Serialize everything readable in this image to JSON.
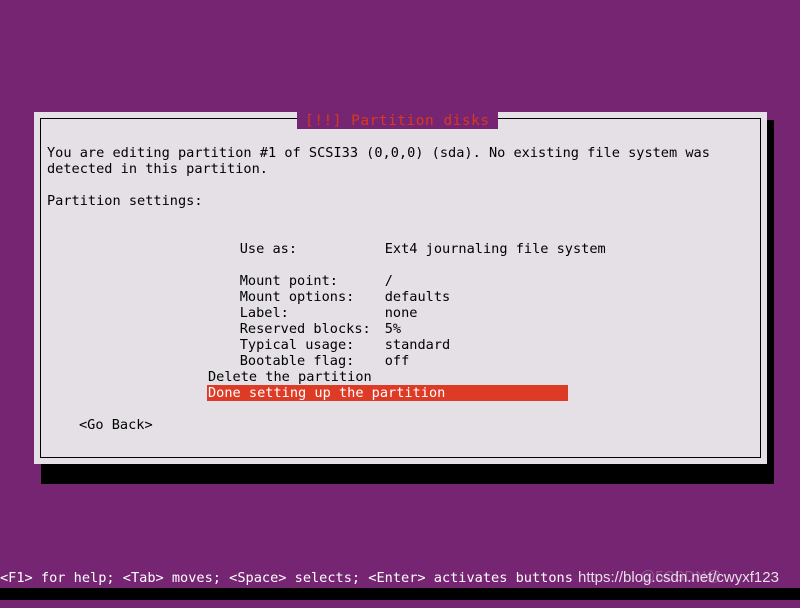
{
  "screen": {
    "background_color": "#762572",
    "accent_color": "#dd3b26",
    "title_color": "#d8381f",
    "panel_color": "#e4e0e5"
  },
  "dialog": {
    "title": "[!!] Partition disks",
    "intro_line_1": "You are editing partition #1 of SCSI33 (0,0,0) (sda). No existing file system was",
    "intro_line_2": "detected in this partition.",
    "settings_heading": "Partition settings:",
    "settings": [
      {
        "label": "Use as:",
        "value": "Ext4 journaling file system"
      },
      {
        "label": "Mount point:",
        "value": "/"
      },
      {
        "label": "Mount options:",
        "value": "defaults"
      },
      {
        "label": "Label:",
        "value": "none"
      },
      {
        "label": "Reserved blocks:",
        "value": "5%"
      },
      {
        "label": "Typical usage:",
        "value": "standard"
      },
      {
        "label": "Bootable flag:",
        "value": "off"
      }
    ],
    "actions": [
      {
        "label": "Delete the partition",
        "selected": false
      },
      {
        "label": "Done setting up the partition",
        "selected": true
      }
    ],
    "go_back": "<Go Back>"
  },
  "status_bar": {
    "text": "<F1> for help; <Tab> moves; <Space> selects; <Enter> activates buttons"
  },
  "watermark": {
    "text": "https://blog.csdn.net/cwyxf123",
    "ghost_text": "@5CSDN@"
  }
}
